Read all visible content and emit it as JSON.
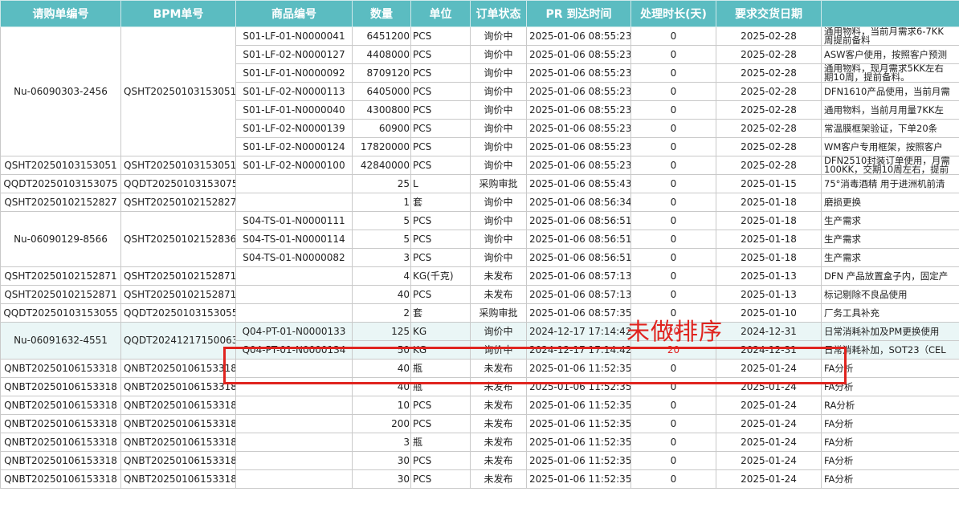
{
  "headers": [
    "请购单编号",
    "BPM单号",
    "商品编号",
    "数量",
    "单位",
    "订单状态",
    "PR 到达时间",
    "处理时长(天)",
    "要求交货日期",
    ""
  ],
  "groups": [
    {
      "req": "Nu-06090303-2456",
      "bpm": "QSHT20250103153051",
      "rows": [
        {
          "item": "S01-LF-01-N0000041",
          "qty": "6451200",
          "unit": "PCS",
          "status": "询价中",
          "arrive": "2025-01-06 08:55:23",
          "dur": "0",
          "due": "2025-02-28",
          "remark": "通用物料，当前月需求6-7KK\n周提前备料"
        },
        {
          "item": "S01-LF-02-N0000127",
          "qty": "4408000",
          "unit": "PCS",
          "status": "询价中",
          "arrive": "2025-01-06 08:55:23",
          "dur": "0",
          "due": "2025-02-28",
          "remark": "ASW客户使用，按照客户预测"
        },
        {
          "item": "S01-LF-01-N0000092",
          "qty": "8709120",
          "unit": "PCS",
          "status": "询价中",
          "arrive": "2025-01-06 08:55:23",
          "dur": "0",
          "due": "2025-02-28",
          "remark": "通用物料，现月需求5KK左右\n期10周，提前备料。"
        },
        {
          "item": "S01-LF-02-N0000113",
          "qty": "6405000",
          "unit": "PCS",
          "status": "询价中",
          "arrive": "2025-01-06 08:55:23",
          "dur": "0",
          "due": "2025-02-28",
          "remark": "DFN1610产品使用，当前月需"
        },
        {
          "item": "S01-LF-01-N0000040",
          "qty": "4300800",
          "unit": "PCS",
          "status": "询价中",
          "arrive": "2025-01-06 08:55:23",
          "dur": "0",
          "due": "2025-02-28",
          "remark": "通用物料，当前月用量7KK左"
        },
        {
          "item": "S01-LF-02-N0000139",
          "qty": "60900",
          "unit": "PCS",
          "status": "询价中",
          "arrive": "2025-01-06 08:55:23",
          "dur": "0",
          "due": "2025-02-28",
          "remark": "常温膜框架验证，下单20条"
        },
        {
          "item": "S01-LF-02-N0000124",
          "qty": "17820000",
          "unit": "PCS",
          "status": "询价中",
          "arrive": "2025-01-06 08:55:23",
          "dur": "0",
          "due": "2025-02-28",
          "remark": "WM客户专用框架，按照客户"
        }
      ]
    },
    {
      "req": "QSHT20250103153051",
      "bpm": "QSHT20250103153051",
      "rows": [
        {
          "item": "S01-LF-02-N0000100",
          "qty": "42840000",
          "unit": "PCS",
          "status": "询价中",
          "arrive": "2025-01-06 08:55:23",
          "dur": "0",
          "due": "2025-02-28",
          "remark": "DFN2510封装订单使用，月需\n100KK，交期10周左右，提前"
        }
      ]
    },
    {
      "req": "QQDT20250103153075",
      "bpm": "QQDT20250103153075",
      "rows": [
        {
          "item": "",
          "qty": "25",
          "unit": "L",
          "status": "采购审批",
          "arrive": "2025-01-06 08:55:43",
          "dur": "0",
          "due": "2025-01-15",
          "remark": "75°消毒酒精 用于进洲机前清"
        }
      ]
    },
    {
      "req": "QSHT20250102152827",
      "bpm": "QSHT20250102152827",
      "rows": [
        {
          "item": "",
          "qty": "1",
          "unit": "套",
          "status": "询价中",
          "arrive": "2025-01-06 08:56:34",
          "dur": "0",
          "due": "2025-01-18",
          "remark": "磨损更换"
        }
      ]
    },
    {
      "req": "Nu-06090129-8566",
      "bpm": "QSHT20250102152836",
      "rows": [
        {
          "item": "S04-TS-01-N0000111",
          "qty": "5",
          "unit": "PCS",
          "status": "询价中",
          "arrive": "2025-01-06 08:56:51",
          "dur": "0",
          "due": "2025-01-18",
          "remark": "生产需求"
        },
        {
          "item": "S04-TS-01-N0000114",
          "qty": "5",
          "unit": "PCS",
          "status": "询价中",
          "arrive": "2025-01-06 08:56:51",
          "dur": "0",
          "due": "2025-01-18",
          "remark": "生产需求"
        },
        {
          "item": "S04-TS-01-N0000082",
          "qty": "3",
          "unit": "PCS",
          "status": "询价中",
          "arrive": "2025-01-06 08:56:51",
          "dur": "0",
          "due": "2025-01-18",
          "remark": "生产需求"
        }
      ]
    },
    {
      "req": "QSHT20250102152871",
      "bpm": "QSHT20250102152871",
      "rows": [
        {
          "item": "",
          "qty": "4",
          "unit": "KG(千克)",
          "status": "未发布",
          "arrive": "2025-01-06 08:57:13",
          "dur": "0",
          "due": "2025-01-13",
          "remark": "DFN 产品放置盒子内，固定产"
        }
      ]
    },
    {
      "req": "QSHT20250102152871",
      "bpm": "QSHT20250102152871",
      "rows": [
        {
          "item": "",
          "qty": "40",
          "unit": "PCS",
          "status": "未发布",
          "arrive": "2025-01-06 08:57:13",
          "dur": "0",
          "due": "2025-01-13",
          "remark": "标记剔除不良品使用"
        }
      ]
    },
    {
      "req": "QQDT20250103153055",
      "bpm": "QQDT20250103153055",
      "rows": [
        {
          "item": "",
          "qty": "2",
          "unit": "套",
          "status": "采购审批",
          "arrive": "2025-01-06 08:57:35",
          "dur": "0",
          "due": "2025-01-10",
          "remark": "厂务工具补充"
        }
      ]
    },
    {
      "req": "Nu-06091632-4551",
      "bpm": "QQDT20241217150063",
      "hl": true,
      "rows": [
        {
          "item": "Q04-PT-01-N0000133",
          "qty": "125",
          "unit": "KG",
          "status": "询价中",
          "arrive": "2024-12-17 17:14:42",
          "dur": "20",
          "due": "2024-12-31",
          "remark": "日常消耗补加及PM更换使用",
          "red": true
        },
        {
          "item": "Q04-PT-01-N0000134",
          "qty": "50",
          "unit": "KG",
          "status": "询价中",
          "arrive": "2024-12-17 17:14:42",
          "dur": "20",
          "due": "2024-12-31",
          "remark": "日常消耗补加，SOT23（CEL",
          "red": true
        }
      ]
    },
    {
      "req": "QNBT20250106153318",
      "bpm": "QNBT20250106153318",
      "rows": [
        {
          "item": "",
          "qty": "40",
          "unit": "瓶",
          "status": "未发布",
          "arrive": "2025-01-06 11:52:35",
          "dur": "0",
          "due": "2025-01-24",
          "remark": "FA分析"
        }
      ]
    },
    {
      "req": "QNBT20250106153318",
      "bpm": "QNBT20250106153318",
      "rows": [
        {
          "item": "",
          "qty": "40",
          "unit": "瓶",
          "status": "未发布",
          "arrive": "2025-01-06 11:52:35",
          "dur": "0",
          "due": "2025-01-24",
          "remark": "FA分析"
        }
      ]
    },
    {
      "req": "QNBT20250106153318",
      "bpm": "QNBT20250106153318",
      "rows": [
        {
          "item": "",
          "qty": "10",
          "unit": "PCS",
          "status": "未发布",
          "arrive": "2025-01-06 11:52:35",
          "dur": "0",
          "due": "2025-01-24",
          "remark": "RA分析"
        }
      ]
    },
    {
      "req": "QNBT20250106153318",
      "bpm": "QNBT20250106153318",
      "rows": [
        {
          "item": "",
          "qty": "200",
          "unit": "PCS",
          "status": "未发布",
          "arrive": "2025-01-06 11:52:35",
          "dur": "0",
          "due": "2025-01-24",
          "remark": "FA分析"
        }
      ]
    },
    {
      "req": "QNBT20250106153318",
      "bpm": "QNBT20250106153318",
      "rows": [
        {
          "item": "",
          "qty": "3",
          "unit": "瓶",
          "status": "未发布",
          "arrive": "2025-01-06 11:52:35",
          "dur": "0",
          "due": "2025-01-24",
          "remark": "FA分析"
        }
      ]
    },
    {
      "req": "QNBT20250106153318",
      "bpm": "QNBT20250106153318",
      "rows": [
        {
          "item": "",
          "qty": "30",
          "unit": "PCS",
          "status": "未发布",
          "arrive": "2025-01-06 11:52:35",
          "dur": "0",
          "due": "2025-01-24",
          "remark": "FA分析"
        }
      ]
    },
    {
      "req": "QNBT20250106153318",
      "bpm": "QNBT20250106153318",
      "rows": [
        {
          "item": "",
          "qty": "30",
          "unit": "PCS",
          "status": "未发布",
          "arrive": "2025-01-06 11:52:35",
          "dur": "0",
          "due": "2025-01-24",
          "remark": "FA分析"
        }
      ]
    }
  ],
  "annotation": {
    "text": "未做排序",
    "color": "#e0241f"
  },
  "colors": {
    "header_bg": "#5bbcc1",
    "highlight_bg": "#eaf6f6",
    "duration_alert": "#e02020"
  }
}
